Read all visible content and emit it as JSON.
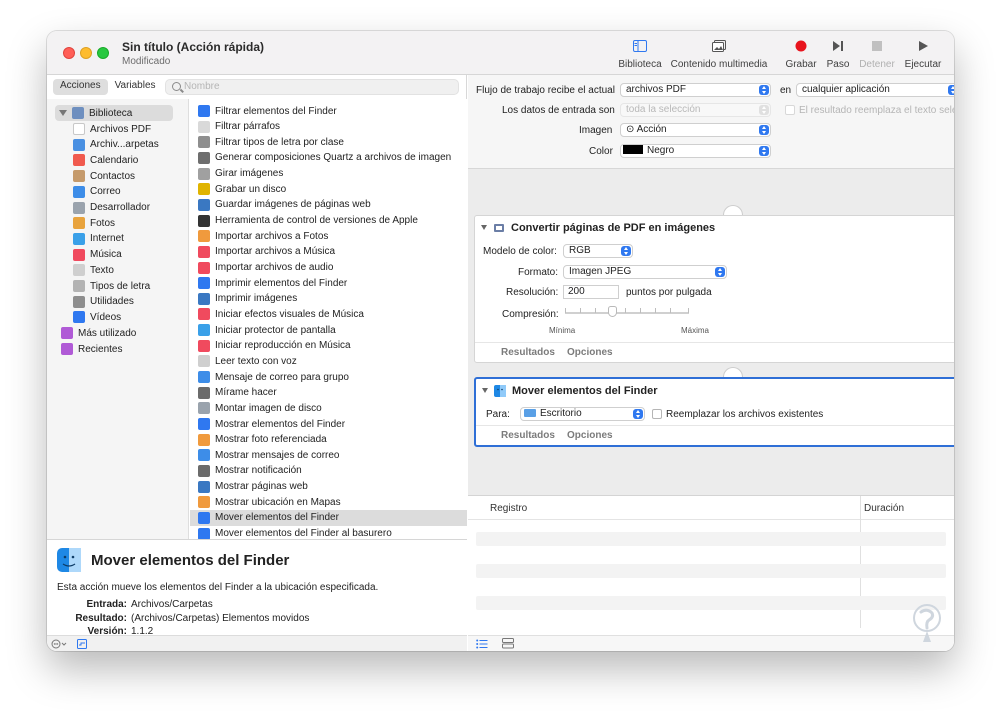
{
  "window": {
    "title": "Sin título (Acción rápida)",
    "subtitle": "Modificado"
  },
  "toolbar": {
    "library": "Biblioteca",
    "media": "Contenido multimedia",
    "record": "Grabar",
    "step": "Paso",
    "stop": "Detener",
    "run": "Ejecutar"
  },
  "left_tabs": {
    "actions": "Acciones",
    "variables": "Variables"
  },
  "search": {
    "placeholder": "Nombre"
  },
  "library": {
    "root": "Biblioteca",
    "items": [
      "Archivos PDF",
      "Archiv...arpetas",
      "Calendario",
      "Contactos",
      "Correo",
      "Desarrollador",
      "Fotos",
      "Internet",
      "Música",
      "Texto",
      "Tipos de letra",
      "Utilidades",
      "Vídeos"
    ],
    "extra": [
      "Más utilizado",
      "Recientes"
    ]
  },
  "actions": [
    "Filtrar elementos del Finder",
    "Filtrar párrafos",
    "Filtrar tipos de letra por clase",
    "Generar composiciones Quartz a archivos de imagen",
    "Girar imágenes",
    "Grabar un disco",
    "Guardar imágenes de páginas web",
    "Herramienta de control de versiones de Apple",
    "Importar archivos a Fotos",
    "Importar archivos a Música",
    "Importar archivos de audio",
    "Imprimir elementos del Finder",
    "Imprimir imágenes",
    "Iniciar efectos visuales de Música",
    "Iniciar protector de pantalla",
    "Iniciar reproducción en Música",
    "Leer texto con voz",
    "Mensaje de correo para grupo",
    "Mírame hacer",
    "Montar imagen de disco",
    "Mostrar elementos del Finder",
    "Mostrar foto referenciada",
    "Mostrar mensajes de correo",
    "Mostrar notificación",
    "Mostrar páginas web",
    "Mostrar ubicación en Mapas",
    "Mover elementos del Finder",
    "Mover elementos del Finder al basurero"
  ],
  "selected_action": "Mover elementos del Finder",
  "description": {
    "title": "Mover elementos del Finder",
    "text": "Esta acción mueve los elementos del Finder a la ubicación especificada.",
    "input_label": "Entrada:",
    "input_value": "Archivos/Carpetas",
    "result_label": "Resultado:",
    "result_value": "(Archivos/Carpetas) Elementos movidos",
    "version_label": "Versión:",
    "version_value": "1.1.2"
  },
  "workflow": {
    "receives_label": "Flujo de trabajo recibe el actual",
    "receives_value": "archivos PDF",
    "in_label": "en",
    "in_value": "cualquier aplicación",
    "input_is_label": "Los datos de entrada son",
    "input_is_value": "toda la selección",
    "replace_text": "El resultado reemplaza el texto selec",
    "image_label": "Imagen",
    "image_value": "⊙ Acción",
    "color_label": "Color",
    "color_value": "Negro",
    "color_swatch": "#000000"
  },
  "card_pdf": {
    "title": "Convertir páginas de PDF en imágenes",
    "color_model_label": "Modelo de color:",
    "color_model_value": "RGB",
    "format_label": "Formato:",
    "format_value": "Imagen JPEG",
    "resolution_label": "Resolución:",
    "resolution_value": "200",
    "resolution_unit": "puntos por pulgada",
    "compression_label": "Compresión:",
    "min_label": "Mínima",
    "max_label": "Máxima",
    "compression_level": 0.38,
    "results_tab": "Resultados",
    "options_tab": "Opciones"
  },
  "card_move": {
    "title": "Mover elementos del Finder",
    "to_label": "Para:",
    "to_value": "Escritorio",
    "replace_label": "Reemplazar los archivos existentes",
    "results_tab": "Resultados",
    "options_tab": "Opciones"
  },
  "log": {
    "col_log": "Registro",
    "col_duration": "Duración"
  },
  "colors": {
    "accent": "#2f78f0",
    "selection": "#dcdcdc",
    "active_border": "#2f6fd6"
  }
}
